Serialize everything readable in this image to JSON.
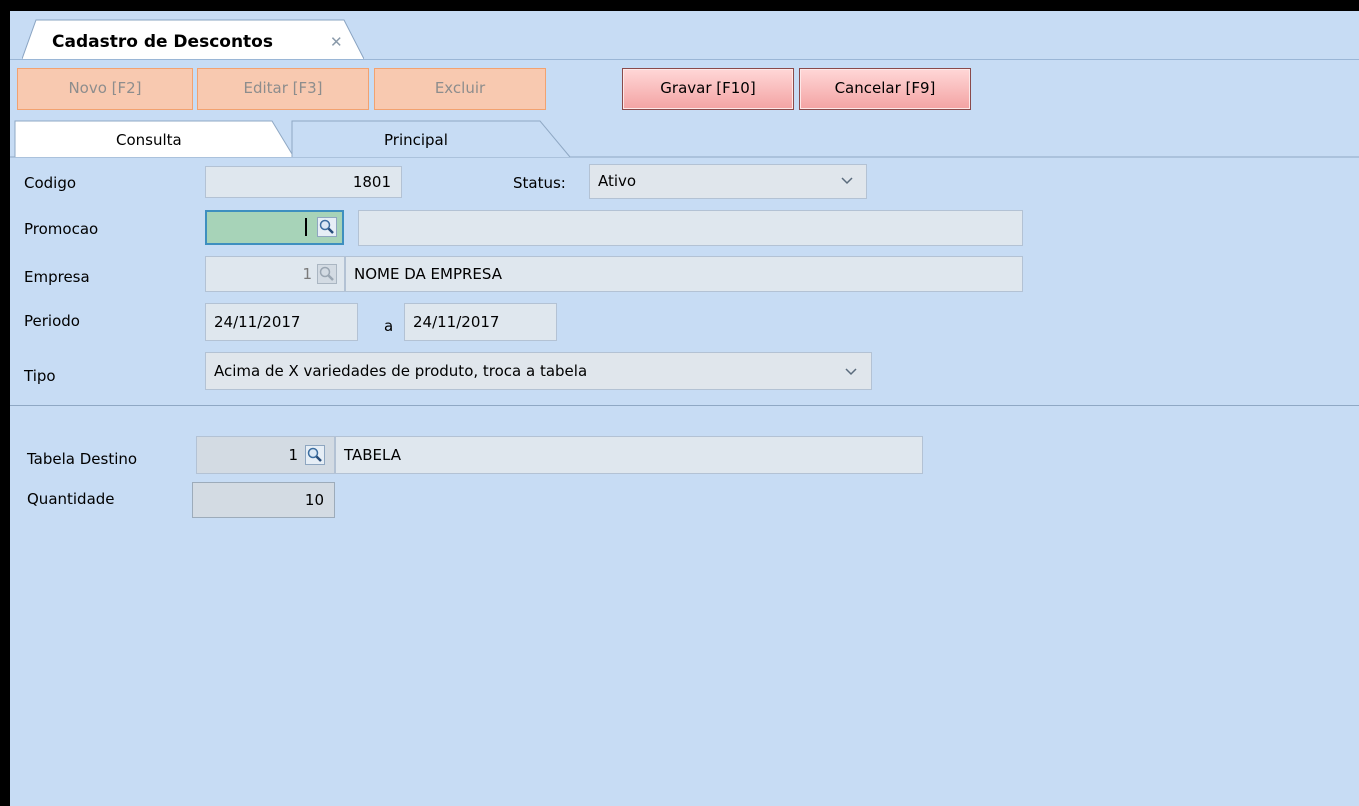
{
  "window": {
    "title_tab": "Cadastro de Descontos"
  },
  "toolbar": {
    "novo": "Novo [F2]",
    "editar": "Editar [F3]",
    "excluir": "Excluir",
    "gravar": "Gravar [F10]",
    "cancelar": "Cancelar [F9]"
  },
  "tabs": {
    "consulta": "Consulta",
    "principal": "Principal"
  },
  "form": {
    "codigo_label": "Codigo",
    "codigo_value": "1801",
    "status_label": "Status:",
    "status_value": "Ativo",
    "promocao_label": "Promocao",
    "promocao_value": "",
    "promocao_desc": "",
    "empresa_label": "Empresa",
    "empresa_code": "1",
    "empresa_name": "NOME DA EMPRESA",
    "periodo_label": "Periodo",
    "periodo_inicio": "24/11/2017",
    "periodo_sep": "a",
    "periodo_fim": "24/11/2017",
    "tipo_label": "Tipo",
    "tipo_value": "Acima de X variedades de produto, troca a tabela"
  },
  "detail": {
    "tabela_label": "Tabela Destino",
    "tabela_code": "1",
    "tabela_name": "TABELA",
    "quantidade_label": "Quantidade",
    "quantidade_value": "10"
  },
  "colors": {
    "background": "#c7dcf4",
    "button_disabled": "#f8c9b0",
    "button_enabled": "#f3a3a3",
    "promocao_field": "#a7d3b8"
  },
  "icons": [
    "close-icon",
    "search-icon",
    "chevron-down-icon"
  ]
}
